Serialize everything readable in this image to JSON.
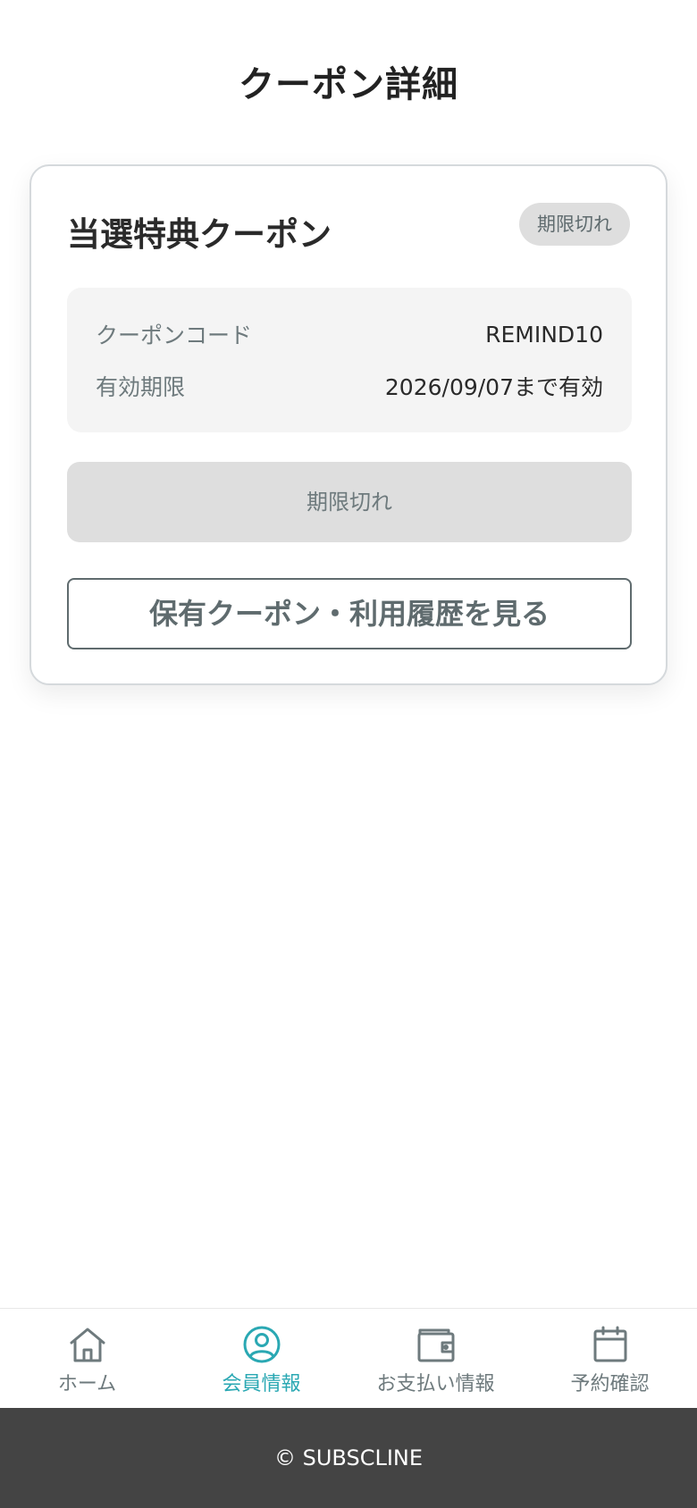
{
  "header": {
    "title": "クーポン詳細"
  },
  "coupon": {
    "title": "当選特典クーポン",
    "status_badge": "期限切れ",
    "code_label": "クーポンコード",
    "code_value": "REMIND10",
    "expiry_label": "有効期限",
    "expiry_value": "2026/09/07まで有効",
    "action_label": "期限切れ",
    "history_label": "保有クーポン・利用履歴を見る"
  },
  "bottom_nav": {
    "active": "member",
    "accent_color": "#2aa8b3",
    "items": [
      {
        "label": "ホーム",
        "icon": "home-icon"
      },
      {
        "label": "会員情報",
        "icon": "user-circle-icon"
      },
      {
        "label": "お支払い情報",
        "icon": "wallet-icon"
      },
      {
        "label": "予約確認",
        "icon": "calendar-icon"
      }
    ]
  },
  "footer": {
    "copyright": "© SUBSCLINE"
  }
}
